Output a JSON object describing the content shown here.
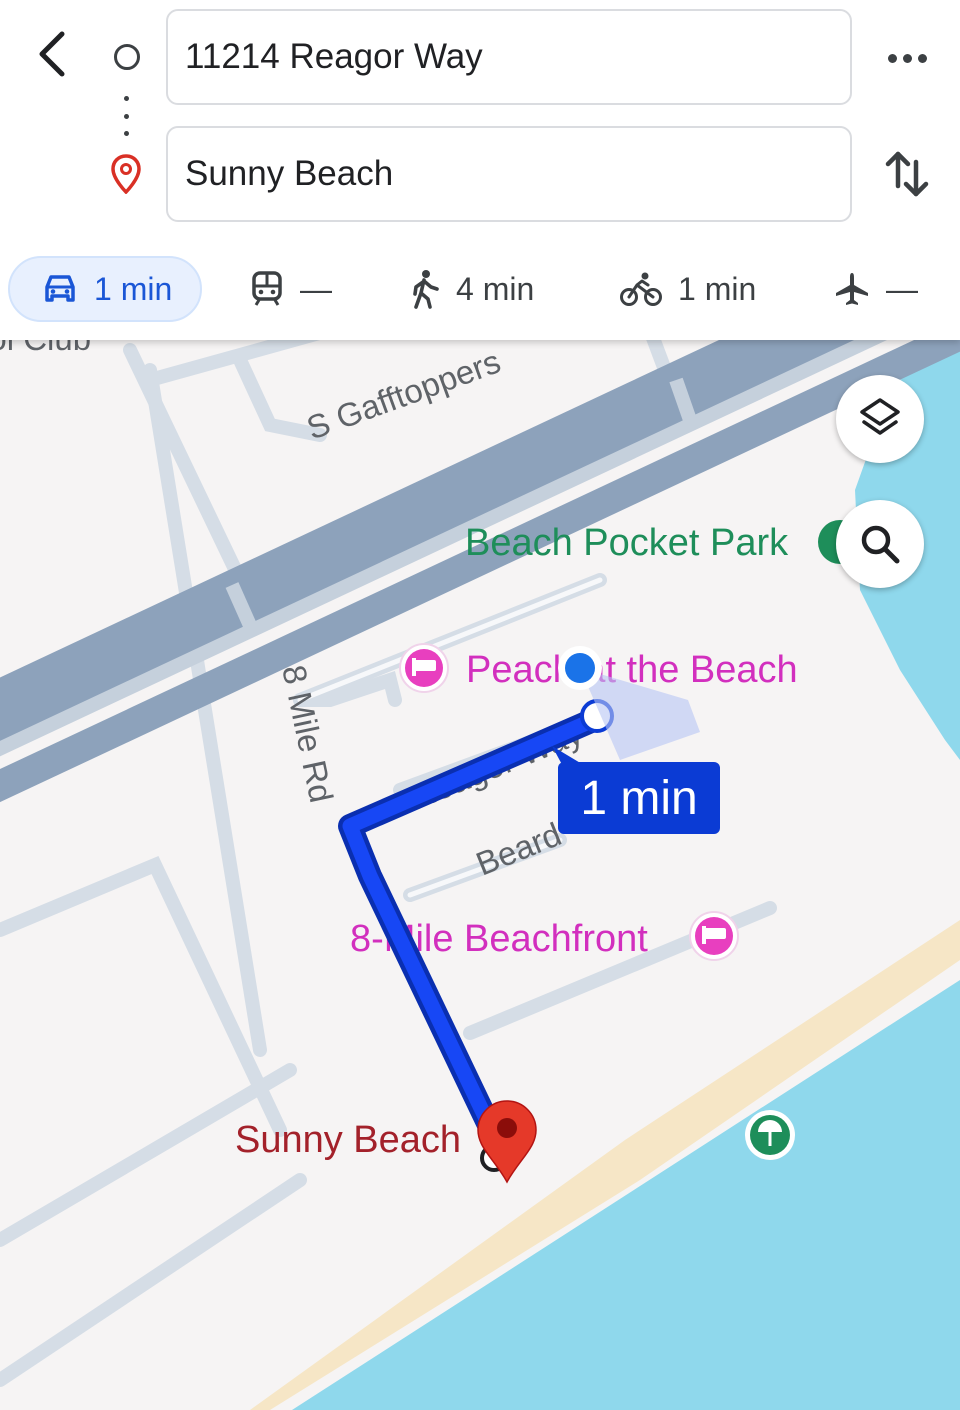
{
  "header": {
    "origin": {
      "value": "11214 Reagor Way",
      "icon": "circle-outline-icon"
    },
    "destination": {
      "value": "Sunny Beach",
      "icon": "map-pin-icon"
    },
    "back_icon": "chevron-left-icon",
    "more_icon": "more-horizontal-icon",
    "swap_icon": "swap-vertical-icon"
  },
  "travel_modes": [
    {
      "mode": "drive",
      "icon": "car-icon",
      "time": "1 min",
      "selected": true
    },
    {
      "mode": "transit",
      "icon": "train-icon",
      "time": "—",
      "selected": false
    },
    {
      "mode": "walk",
      "icon": "walking-icon",
      "time": "4 min",
      "selected": false
    },
    {
      "mode": "bike",
      "icon": "bicycle-icon",
      "time": "1 min",
      "selected": false
    },
    {
      "mode": "flight",
      "icon": "airplane-icon",
      "time": "—",
      "selected": false
    }
  ],
  "map": {
    "labels": {
      "top_partial": "ool Club",
      "gafftoppers": "S Gafftoppers",
      "mile_rd": "8 Mile Rd",
      "reagor_way": "Reagor Way",
      "beard": "Beard"
    },
    "pois": {
      "park": "Beach Pocket Park",
      "hotel_1": "Peach at the Beach",
      "hotel_2": "8-Mile Beachfront",
      "destination": "Sunny Beach"
    },
    "eta_label": "1 min",
    "buttons": {
      "layers_icon": "layers-icon",
      "search_icon": "search-icon"
    }
  },
  "colors": {
    "route": "#0b3bd4",
    "water": "#8fd8ec",
    "sand": "#f6e6c6",
    "highway": "#8da2bb",
    "selected_mode_bg": "#e8f0fe",
    "destination_pin": "#d93025"
  }
}
